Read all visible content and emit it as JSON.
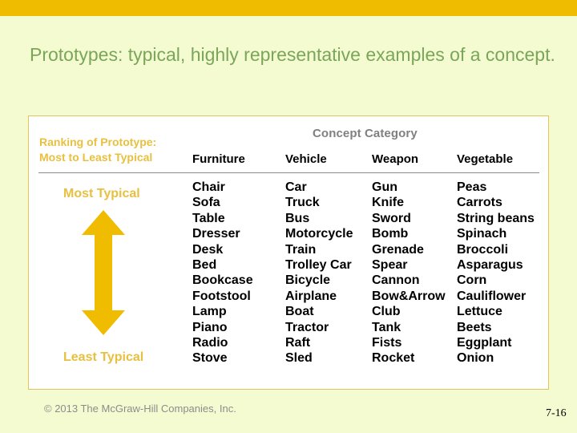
{
  "slide": {
    "title": "Prototypes: typical, highly representative examples of a concept.",
    "copyright": "© 2013 The McGraw-Hill Companies, Inc.",
    "page_number": "7-16",
    "colors": {
      "accent": "#f0bc00",
      "title": "#7aa55a",
      "background": "#f5fbd0"
    }
  },
  "table": {
    "concept_category_label": "Concept Category",
    "ranking_label_line1": "Ranking of Prototype:",
    "ranking_label_line2": "Most to Least Typical",
    "most_typical_label": "Most Typical",
    "least_typical_label": "Least Typical",
    "arrow_icon": "double-headed-vertical-arrow",
    "columns": [
      {
        "header": "Furniture",
        "items": [
          "Chair",
          "Sofa",
          "Table",
          "Dresser",
          "Desk",
          "Bed",
          "Bookcase",
          "Footstool",
          "Lamp",
          "Piano",
          "Radio",
          "Stove"
        ]
      },
      {
        "header": "Vehicle",
        "items": [
          "Car",
          "Truck",
          "Bus",
          "Motorcycle",
          "Train",
          "Trolley Car",
          "Bicycle",
          "Airplane",
          "Boat",
          "Tractor",
          "Raft",
          "Sled"
        ]
      },
      {
        "header": "Weapon",
        "items": [
          "Gun",
          "Knife",
          "Sword",
          "Bomb",
          "Grenade",
          "Spear",
          "Cannon",
          "Bow&Arrow",
          "Club",
          "Tank",
          "Fists",
          "Rocket"
        ]
      },
      {
        "header": "Vegetable",
        "items": [
          "Peas",
          "Carrots",
          "String beans",
          "Spinach",
          "Broccoli",
          "Asparagus",
          "Corn",
          "Cauliflower",
          "Lettuce",
          "Beets",
          "Eggplant",
          "Onion"
        ]
      }
    ]
  }
}
